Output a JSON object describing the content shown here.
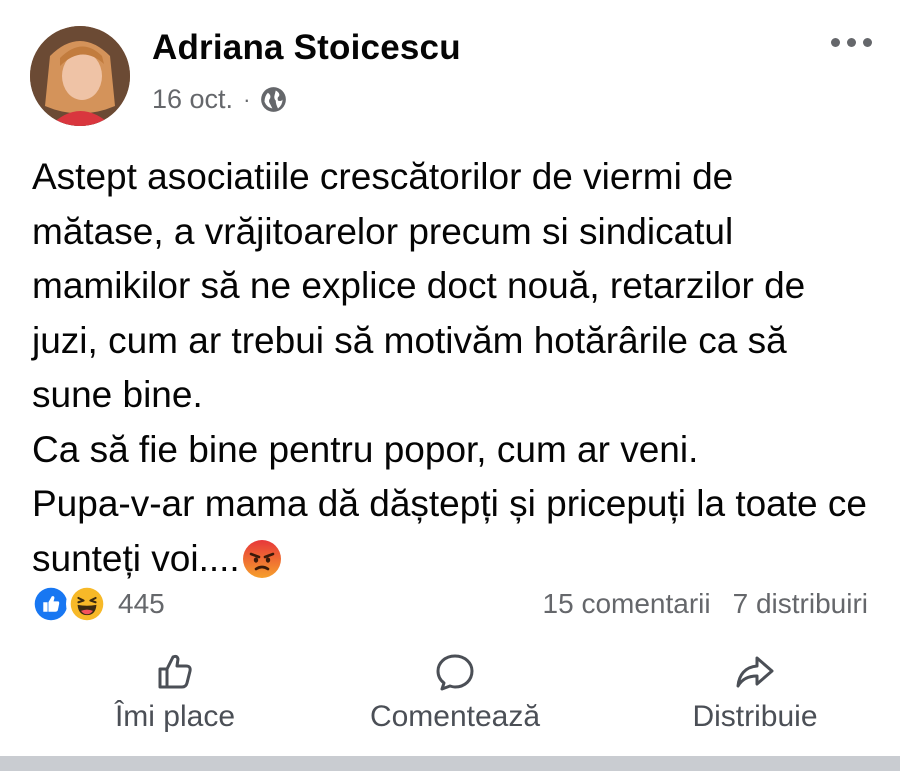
{
  "post": {
    "author": "Adriana Stoicescu",
    "date": "16 oct.",
    "separator": "·",
    "privacy_icon": "globe-icon",
    "text": "Astept asociatiile crescătorilor de viermi de mătase, a vrăjitoarelor precum si sindicatul mamikilor să ne explice doct nouă, retarzilor de juzi, cum ar trebui să motivăm hotărârile ca să sune bine.\nCa să fie bine pentru popor, cum ar veni.\nPupa-v-ar mama dă dăștepți și pricepuți la toate ce sunteți voi....",
    "trailing_emoji": "angry-emoji"
  },
  "reactions": {
    "icons": [
      "like-reaction-icon",
      "haha-reaction-icon"
    ],
    "count": "445",
    "comments": "15 comentarii",
    "shares": "7 distribuiri"
  },
  "actions": {
    "like": "Îmi place",
    "comment": "Comentează",
    "share": "Distribuie"
  },
  "colors": {
    "text": "#050505",
    "secondary": "#65676b",
    "like_blue": "#1877f2",
    "haha_yellow": "#f7b928",
    "angry_red": "#e9710f"
  }
}
